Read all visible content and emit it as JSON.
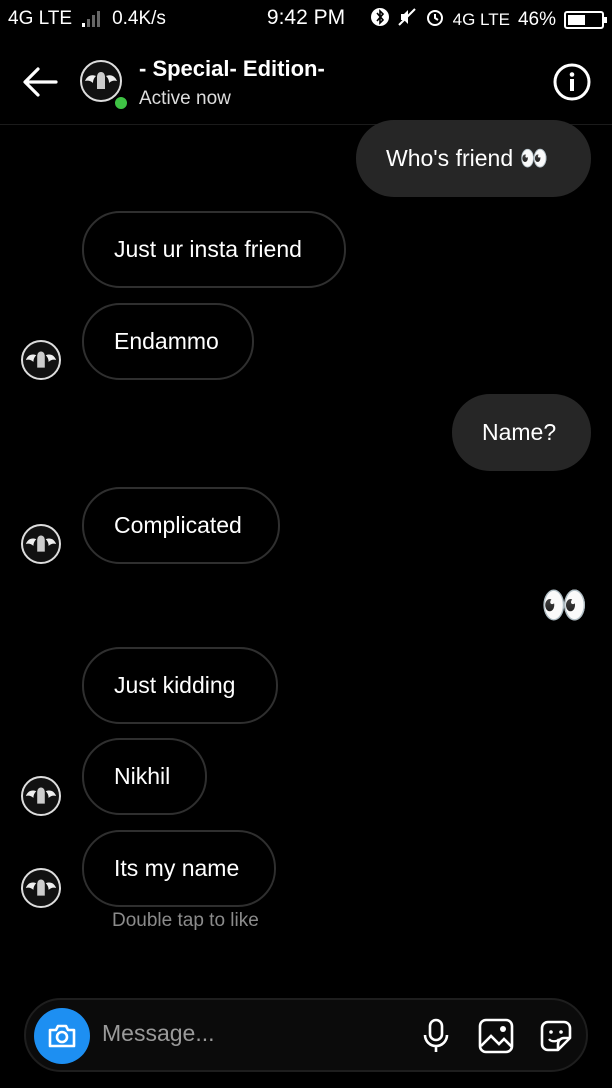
{
  "status_bar": {
    "network_left": "4G LTE",
    "speed": "0.4K/s",
    "time": "9:42 PM",
    "network_right": "4G LTE",
    "battery": "46%"
  },
  "header": {
    "name": "- Special- Edition-",
    "status": "Active now",
    "back_icon": "arrow-left-icon",
    "info_icon": "info-icon"
  },
  "messages": [
    {
      "text": "Who's friend 👀",
      "side": "out"
    },
    {
      "text": "Just ur insta friend",
      "side": "in"
    },
    {
      "text": "Endammo",
      "side": "in"
    },
    {
      "text": "Name?",
      "side": "out"
    },
    {
      "text": "Complicated",
      "side": "in"
    },
    {
      "text": "👀",
      "side": "out"
    },
    {
      "text": "Just kidding",
      "side": "in"
    },
    {
      "text": "Nikhil",
      "side": "in"
    },
    {
      "text": "Its my name",
      "side": "in"
    }
  ],
  "double_tap_hint": "Double tap to like",
  "composer": {
    "placeholder": "Message...",
    "icons": [
      "camera-icon",
      "microphone-icon",
      "gallery-icon",
      "sticker-icon"
    ]
  },
  "colors": {
    "background": "#000000",
    "outgoing_bubble": "#262626",
    "incoming_border": "#2f2f2f",
    "online_dot": "#3ec244",
    "camera_button": "#1d8ff2"
  }
}
